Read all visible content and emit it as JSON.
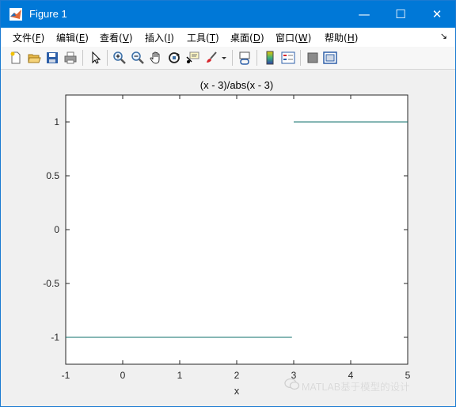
{
  "window": {
    "title": "Figure 1",
    "minimize_glyph": "—",
    "maximize_glyph": "☐",
    "close_glyph": "✕"
  },
  "menu": {
    "items": [
      {
        "label": "文件(",
        "key": "F",
        "tail": ")"
      },
      {
        "label": "编辑(",
        "key": "E",
        "tail": ")"
      },
      {
        "label": "查看(",
        "key": "V",
        "tail": ")"
      },
      {
        "label": "插入(",
        "key": "I",
        "tail": ")"
      },
      {
        "label": "工具(",
        "key": "T",
        "tail": ")"
      },
      {
        "label": "桌面(",
        "key": "D",
        "tail": ")"
      },
      {
        "label": "窗口(",
        "key": "W",
        "tail": ")"
      },
      {
        "label": "帮助(",
        "key": "H",
        "tail": ")"
      }
    ],
    "dock_glyph": "↘"
  },
  "toolbar": {
    "icons": [
      "new-figure-icon",
      "open-file-icon",
      "save-icon",
      "print-icon",
      "pointer-icon",
      "zoom-in-icon",
      "zoom-out-icon",
      "pan-hand-icon",
      "rotate-3d-icon",
      "data-cursor-icon",
      "brush-icon",
      "brush-dropdown-icon",
      "link-plot-icon",
      "colorbar-icon",
      "legend-icon",
      "hide-plot-tools-icon",
      "show-plot-tools-icon"
    ]
  },
  "chart_data": {
    "type": "line",
    "title": "(x - 3)/abs(x - 3)",
    "xlabel": "x",
    "ylabel": "",
    "xlim": [
      -1,
      5
    ],
    "ylim": [
      -1.25,
      1.25
    ],
    "xticks": [
      "-1",
      "0",
      "1",
      "2",
      "3",
      "4",
      "5"
    ],
    "xtick_values": [
      -1,
      0,
      1,
      2,
      3,
      4,
      5
    ],
    "yticks": [
      "1",
      "0.5",
      "0",
      "-0.5",
      "-1"
    ],
    "ytick_values": [
      1,
      0.5,
      0,
      -0.5,
      -1
    ],
    "series": [
      {
        "x": [
          -1,
          2.97
        ],
        "y": [
          -1,
          -1
        ],
        "color": "#0e6f6a"
      },
      {
        "x": [
          3.0,
          5
        ],
        "y": [
          1,
          1
        ],
        "color": "#0e6f6a"
      }
    ],
    "grid": false
  },
  "watermark": {
    "text": "MATLAB基于模型的设计"
  }
}
